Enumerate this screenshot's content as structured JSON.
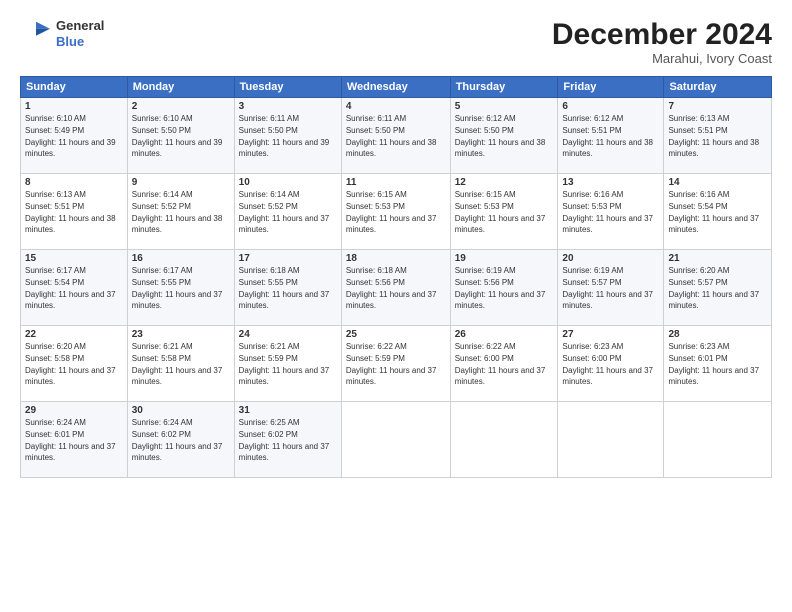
{
  "header": {
    "logo_line1": "General",
    "logo_line2": "Blue",
    "month_title": "December 2024",
    "location": "Marahui, Ivory Coast"
  },
  "weekdays": [
    "Sunday",
    "Monday",
    "Tuesday",
    "Wednesday",
    "Thursday",
    "Friday",
    "Saturday"
  ],
  "weeks": [
    [
      {
        "day": "1",
        "sunrise": "6:10 AM",
        "sunset": "5:49 PM",
        "daylight": "11 hours and 39 minutes."
      },
      {
        "day": "2",
        "sunrise": "6:10 AM",
        "sunset": "5:50 PM",
        "daylight": "11 hours and 39 minutes."
      },
      {
        "day": "3",
        "sunrise": "6:11 AM",
        "sunset": "5:50 PM",
        "daylight": "11 hours and 39 minutes."
      },
      {
        "day": "4",
        "sunrise": "6:11 AM",
        "sunset": "5:50 PM",
        "daylight": "11 hours and 38 minutes."
      },
      {
        "day": "5",
        "sunrise": "6:12 AM",
        "sunset": "5:50 PM",
        "daylight": "11 hours and 38 minutes."
      },
      {
        "day": "6",
        "sunrise": "6:12 AM",
        "sunset": "5:51 PM",
        "daylight": "11 hours and 38 minutes."
      },
      {
        "day": "7",
        "sunrise": "6:13 AM",
        "sunset": "5:51 PM",
        "daylight": "11 hours and 38 minutes."
      }
    ],
    [
      {
        "day": "8",
        "sunrise": "6:13 AM",
        "sunset": "5:51 PM",
        "daylight": "11 hours and 38 minutes."
      },
      {
        "day": "9",
        "sunrise": "6:14 AM",
        "sunset": "5:52 PM",
        "daylight": "11 hours and 38 minutes."
      },
      {
        "day": "10",
        "sunrise": "6:14 AM",
        "sunset": "5:52 PM",
        "daylight": "11 hours and 37 minutes."
      },
      {
        "day": "11",
        "sunrise": "6:15 AM",
        "sunset": "5:53 PM",
        "daylight": "11 hours and 37 minutes."
      },
      {
        "day": "12",
        "sunrise": "6:15 AM",
        "sunset": "5:53 PM",
        "daylight": "11 hours and 37 minutes."
      },
      {
        "day": "13",
        "sunrise": "6:16 AM",
        "sunset": "5:53 PM",
        "daylight": "11 hours and 37 minutes."
      },
      {
        "day": "14",
        "sunrise": "6:16 AM",
        "sunset": "5:54 PM",
        "daylight": "11 hours and 37 minutes."
      }
    ],
    [
      {
        "day": "15",
        "sunrise": "6:17 AM",
        "sunset": "5:54 PM",
        "daylight": "11 hours and 37 minutes."
      },
      {
        "day": "16",
        "sunrise": "6:17 AM",
        "sunset": "5:55 PM",
        "daylight": "11 hours and 37 minutes."
      },
      {
        "day": "17",
        "sunrise": "6:18 AM",
        "sunset": "5:55 PM",
        "daylight": "11 hours and 37 minutes."
      },
      {
        "day": "18",
        "sunrise": "6:18 AM",
        "sunset": "5:56 PM",
        "daylight": "11 hours and 37 minutes."
      },
      {
        "day": "19",
        "sunrise": "6:19 AM",
        "sunset": "5:56 PM",
        "daylight": "11 hours and 37 minutes."
      },
      {
        "day": "20",
        "sunrise": "6:19 AM",
        "sunset": "5:57 PM",
        "daylight": "11 hours and 37 minutes."
      },
      {
        "day": "21",
        "sunrise": "6:20 AM",
        "sunset": "5:57 PM",
        "daylight": "11 hours and 37 minutes."
      }
    ],
    [
      {
        "day": "22",
        "sunrise": "6:20 AM",
        "sunset": "5:58 PM",
        "daylight": "11 hours and 37 minutes."
      },
      {
        "day": "23",
        "sunrise": "6:21 AM",
        "sunset": "5:58 PM",
        "daylight": "11 hours and 37 minutes."
      },
      {
        "day": "24",
        "sunrise": "6:21 AM",
        "sunset": "5:59 PM",
        "daylight": "11 hours and 37 minutes."
      },
      {
        "day": "25",
        "sunrise": "6:22 AM",
        "sunset": "5:59 PM",
        "daylight": "11 hours and 37 minutes."
      },
      {
        "day": "26",
        "sunrise": "6:22 AM",
        "sunset": "6:00 PM",
        "daylight": "11 hours and 37 minutes."
      },
      {
        "day": "27",
        "sunrise": "6:23 AM",
        "sunset": "6:00 PM",
        "daylight": "11 hours and 37 minutes."
      },
      {
        "day": "28",
        "sunrise": "6:23 AM",
        "sunset": "6:01 PM",
        "daylight": "11 hours and 37 minutes."
      }
    ],
    [
      {
        "day": "29",
        "sunrise": "6:24 AM",
        "sunset": "6:01 PM",
        "daylight": "11 hours and 37 minutes."
      },
      {
        "day": "30",
        "sunrise": "6:24 AM",
        "sunset": "6:02 PM",
        "daylight": "11 hours and 37 minutes."
      },
      {
        "day": "31",
        "sunrise": "6:25 AM",
        "sunset": "6:02 PM",
        "daylight": "11 hours and 37 minutes."
      },
      null,
      null,
      null,
      null
    ]
  ]
}
